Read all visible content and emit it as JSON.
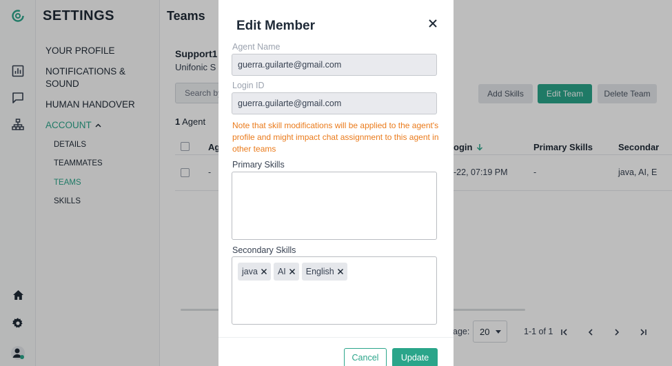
{
  "iconbar": {
    "logo_icon": "logo-icon",
    "items": [
      "analytics-icon",
      "chat-icon",
      "org-chart-icon"
    ],
    "bottom": [
      "home-icon",
      "settings-icon",
      "avatar"
    ]
  },
  "settings": {
    "title": "SETTINGS",
    "items": [
      {
        "label": "YOUR PROFILE"
      },
      {
        "label": "NOTIFICATIONS &\nSOUND"
      },
      {
        "label": "HUMAN HANDOVER"
      },
      {
        "label": "ACCOUNT"
      }
    ],
    "sub_items": [
      "DETAILS",
      "TEAMMATES",
      "TEAMS",
      "SKILLS"
    ]
  },
  "page": {
    "title": "Teams",
    "team_name": "Support1",
    "team_sub": "Unifonic S",
    "search_placeholder": "Search by",
    "buttons": {
      "add_skills": "Add Skills",
      "edit_team": "Edit Team",
      "delete_team": "Delete Team"
    },
    "agent_count_num": "1",
    "agent_count_label": "Agent",
    "columns": {
      "agent": "Ag",
      "last_login": "ogin",
      "primary": "Primary Skills",
      "secondary": "Secondar"
    },
    "row": {
      "agent": "-",
      "last_login": "-22, 07:19 PM",
      "primary": "-",
      "secondary": "java, AI, E"
    },
    "pager": {
      "rows_label": "age:",
      "rows_value": "20",
      "range": "1-1 of 1"
    }
  },
  "modal": {
    "title": "Edit Member",
    "agent_name_label": "Agent Name",
    "agent_name_value": "guerra.guilarte@gmail.com",
    "login_id_label": "Login ID",
    "login_id_value": "guerra.guilarte@gmail.com",
    "warning": "Note that skill modifications will be applied to the agent's profile and might impact chat assignment to this agent in other teams",
    "primary_label": "Primary Skills",
    "secondary_label": "Secondary Skills",
    "secondary_chips": [
      "java",
      "AI",
      "English"
    ],
    "cancel": "Cancel",
    "update": "Update"
  },
  "colors": {
    "accent": "#2aa58a",
    "warning": "#ea7a1a"
  }
}
